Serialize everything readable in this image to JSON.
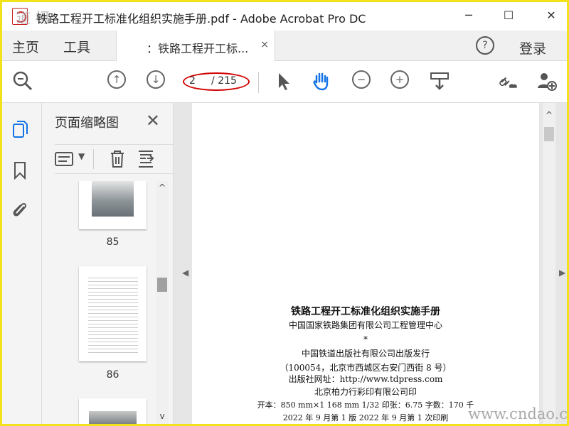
{
  "window": {
    "title": "铁路工程开工标准化组织实施手册.pdf - Adobe Acrobat Pro DC",
    "minimize": "─",
    "maximize": "☐",
    "close": "✕"
  },
  "menubar": {
    "home": "主页",
    "tools": "工具",
    "tab_label": "：铁路工程开工标...",
    "tab_close": "×",
    "help": "?",
    "login": "登录"
  },
  "toolbar": {
    "page_current": "2",
    "page_total": "/ 215"
  },
  "left_panel": {
    "title": "页面缩略图",
    "close": "✕",
    "thumbnails": [
      {
        "page_label": "85"
      },
      {
        "page_label": "86"
      }
    ]
  },
  "document": {
    "lines": [
      "铁路工程开工标准化组织实施手册",
      "中国国家铁路集团有限公司工程管理中心",
      "*",
      "中国铁道出版社有限公司出版发行",
      "（100054，北京市西城区右安门西街 8 号）",
      "出版社网址：http://www.tdpress.com",
      "北京柏力行彩印有限公司印",
      "开本：850 mm×1 168 mm 1/32   印张：6.75   字数：170 千",
      "2022 年 9 月第 1 版   2022 年 9 月第 1 次印刷"
    ]
  },
  "watermark": {
    "site": "www.cndao.com",
    "logo": "道 柯"
  },
  "colors": {
    "highlight_oval": "#d20000",
    "border_frame": "#f2e21b",
    "hand_tool_blue": "#1473e6"
  }
}
